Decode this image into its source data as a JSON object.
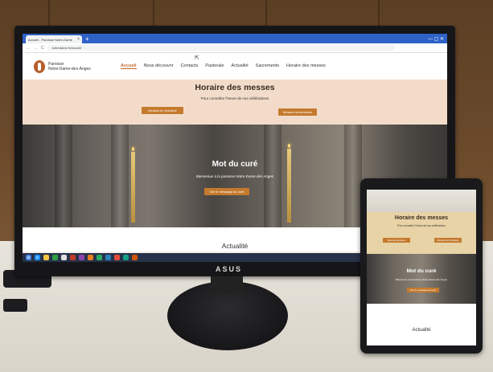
{
  "browser": {
    "tab_label": "Accueil - Paroisse Notre-Dame",
    "tab_close": "×",
    "new_tab": "+",
    "window_controls": "— ▢ ✕",
    "url": "notredame.fr/accueil",
    "nav_back": "←",
    "nav_forward": "→",
    "nav_reload": "C"
  },
  "site": {
    "logo_line1": "Paroisse",
    "logo_line2": "Notre-Dame-des-Anges",
    "nav": [
      "Accueil",
      "Nous découvrir",
      "Contacts",
      "Pastorale",
      "Actualité",
      "Sacrements",
      "Horaire des messes"
    ],
    "horaire_title": "Horaire des messes",
    "horaire_subtitle": "Pour connaître l'heure de nos célébrations",
    "btn_left": "Messes en semaine",
    "btn_right": "Messes dominicales",
    "mot_title": "Mot du curé",
    "mot_subtitle": "Bienvenue à la paroisse Notre-Dame des Anges",
    "mot_button": "Voir le message du curé",
    "actualite_title": "Actualité"
  },
  "monitor": {
    "brand": "ASUS"
  },
  "tablet": {
    "horaire_title": "Horaire des messes",
    "horaire_subtitle": "Pour connaître l'heure de nos célébrations",
    "btn_left": "Messes semaine",
    "btn_right": "Messes dominicales",
    "mot_title": "Mot du curé",
    "mot_subtitle": "Bienvenue à la paroisse Notre-Dame des Anges",
    "mot_button": "Voir le message du curé",
    "actualite_title": "Actualité"
  },
  "colors": {
    "accent": "#c57a2e",
    "taskbar": "#27324a",
    "horaire_bg": "#f2dcc9"
  }
}
